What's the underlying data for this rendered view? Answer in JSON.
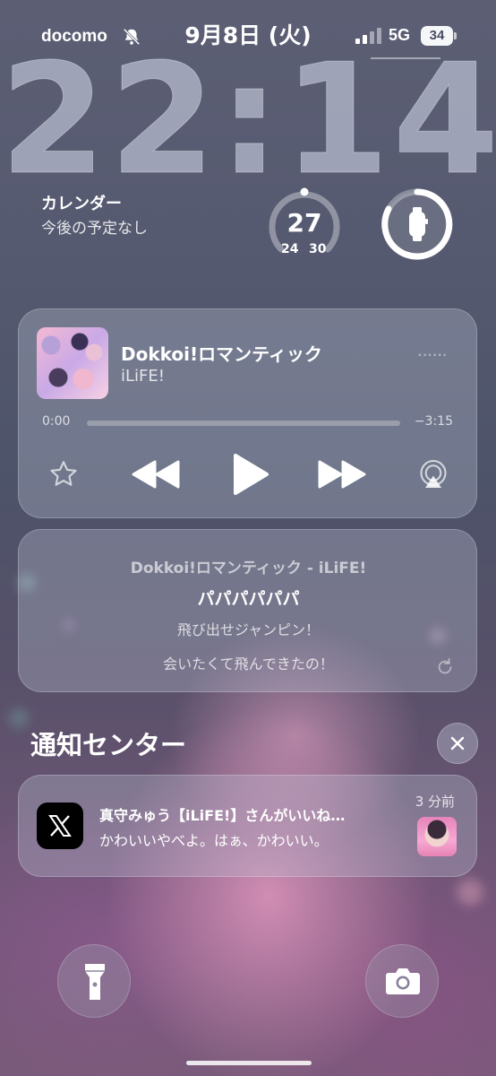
{
  "status_bar": {
    "carrier": "docomo",
    "date": "9月8日 (火)",
    "network": "5G",
    "battery": "34"
  },
  "clock": {
    "time": "22:14"
  },
  "calendar_widget": {
    "title": "カレンダー",
    "subtitle": "今後の予定なし"
  },
  "gauge_widget": {
    "value": "27",
    "min": "24",
    "max": "30",
    "level": 0.5
  },
  "watch_widget": {
    "icon": "apple-watch-icon",
    "battery_level": 0.8
  },
  "now_playing": {
    "title": "Dokkoi!ロマンティック",
    "artist": "iLiFE!",
    "elapsed": "0:00",
    "remaining": "−3:15",
    "progress": 0.0
  },
  "lyrics": {
    "header": "Dokkoi!ロマンティック - iLiFE!",
    "current": "パパパパパパ",
    "next": [
      "飛び出せジャンピン！",
      "会いたくて飛んできたの！"
    ]
  },
  "notification_center": {
    "title": "通知センター"
  },
  "notification": {
    "app_icon": "x-icon",
    "title": "真守みゅう【iLiFE!】さんがいいね…",
    "body": "かわいいやべよ。はぁ、かわいい。",
    "time": "3 分前"
  },
  "quick_actions": {
    "left": "flashlight-icon",
    "right": "camera-icon"
  }
}
